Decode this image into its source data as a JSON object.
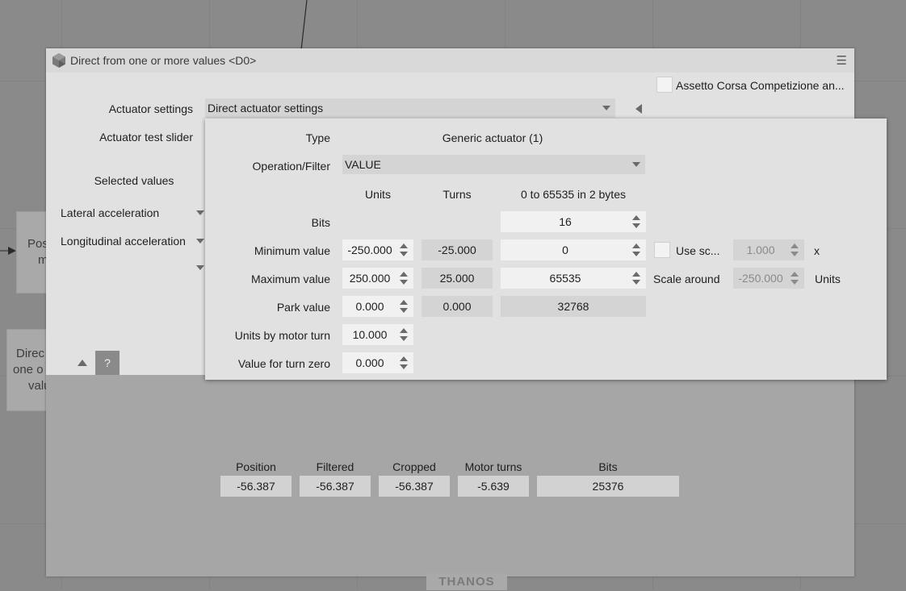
{
  "window": {
    "title": "Direct from one or more values <D0>"
  },
  "game_checkbox_label": "Assetto Corsa Competizione an...",
  "actuator_settings": {
    "label": "Actuator settings",
    "value": "Direct actuator settings"
  },
  "actuator_test_slider_label": "Actuator test slider",
  "selected_values": {
    "label": "Selected values",
    "items": [
      "Lateral acceleration",
      "Longitudinal acceleration"
    ]
  },
  "background_nodes": {
    "node1": [
      "Pos",
      "m"
    ],
    "node2": [
      "Direc",
      "one o",
      "valu"
    ]
  },
  "popup": {
    "type_label": "Type",
    "type_value": "Generic actuator (1)",
    "operation_label": "Operation/Filter",
    "operation_value": "VALUE",
    "col_units": "Units",
    "col_turns": "Turns",
    "col_range": "0 to 65535 in 2 bytes",
    "bits_label": "Bits",
    "bits_value": "16",
    "min_label": "Minimum value",
    "min_units": "-250.000",
    "min_turns": "-25.000",
    "min_raw": "0",
    "max_label": "Maximum value",
    "max_units": "250.000",
    "max_turns": "25.000",
    "max_raw": "65535",
    "park_label": "Park value",
    "park_units": "0.000",
    "park_turns": "0.000",
    "park_raw": "32768",
    "units_turn_label": "Units by motor turn",
    "units_turn_value": "10.000",
    "turn_zero_label": "Value for turn zero",
    "turn_zero_value": "0.000",
    "use_scale_label": "Use sc...",
    "scale_value": "1.000",
    "scale_suffix": "x",
    "scale_around_label": "Scale around",
    "scale_around_value": "-250.000",
    "scale_around_suffix": "Units"
  },
  "help_label": "?",
  "stats": {
    "labels": [
      "Position",
      "Filtered",
      "Cropped",
      "Motor turns",
      "Bits"
    ],
    "values": [
      "-56.387",
      "-56.387",
      "-56.387",
      "-5.639",
      "25376"
    ]
  },
  "watermark": "THANOS",
  "colors": {
    "background": "#8a8a8a",
    "panel": "#e1e1e1",
    "field": "#f1f1f1",
    "readonly_field": "#d4d4d4"
  },
  "icons": {
    "app": "hexagon-logo-icon",
    "menu": "hamburger-menu-icon"
  }
}
